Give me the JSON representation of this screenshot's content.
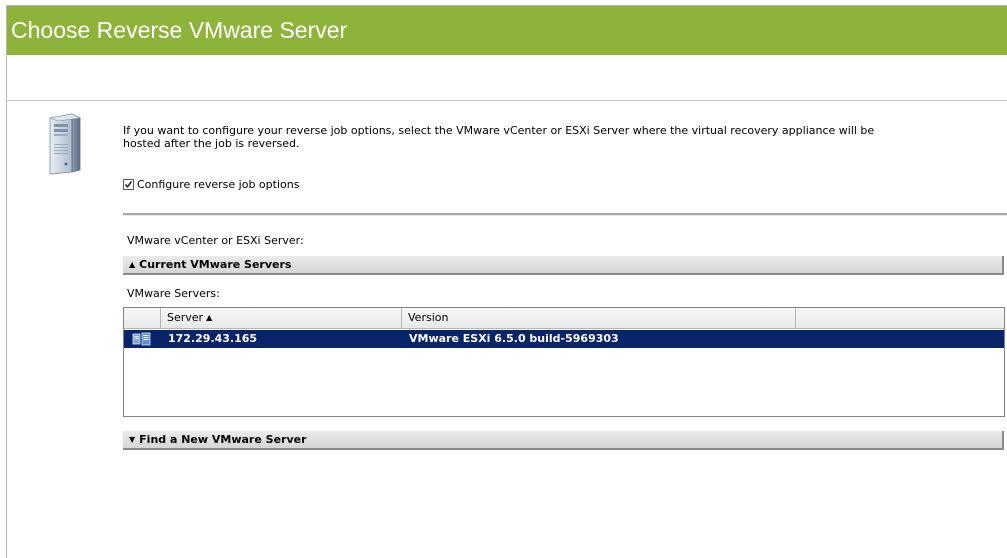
{
  "header": {
    "title": "Choose Reverse VMware Server",
    "title_bg_color": "#8db33a"
  },
  "intro": {
    "icon": "server-tower-icon",
    "description": "If you want to configure your reverse job options, select the VMware vCenter or ESXi Server where the virtual recovery appliance will be hosted after the job is reversed.",
    "configure_checkbox_label": "Configure reverse job options",
    "configure_checked": true
  },
  "server_section": {
    "label": "VMware vCenter or ESXi Server:",
    "current_group": {
      "title": "Current VMware Servers",
      "expanded": true,
      "servers_label": "VMware Servers:",
      "columns": {
        "server": "Server",
        "version": "Version",
        "extra": ""
      },
      "sort_column": "server",
      "rows": [
        {
          "icon": "vmware-host-icon",
          "server": "172.29.43.165",
          "version": "VMware ESXi 6.5.0 build-5969303",
          "selected": true
        }
      ]
    },
    "find_group": {
      "title": "Find a New VMware Server",
      "expanded": false
    }
  },
  "colors": {
    "selection": "#0a246a",
    "accent": "#8db33a"
  }
}
